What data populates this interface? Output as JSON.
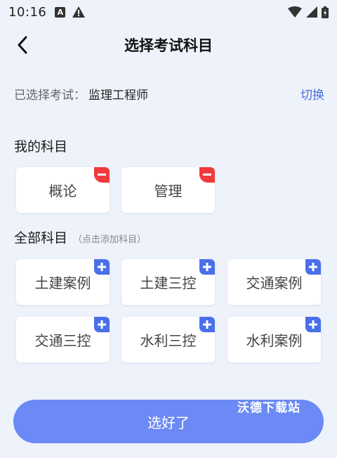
{
  "status_bar": {
    "time": "10:16",
    "notif_a": "A"
  },
  "header": {
    "title": "选择考试科目"
  },
  "exam": {
    "label": "已选择考试：",
    "value": "监理工程师",
    "switch_label": "切换"
  },
  "my_subjects": {
    "title": "我的科目",
    "items": [
      {
        "label": "概论"
      },
      {
        "label": "管理"
      }
    ]
  },
  "all_subjects": {
    "title": "全部科目",
    "hint": "（点击添加科目）",
    "items": [
      {
        "label": "土建案例"
      },
      {
        "label": "土建三控"
      },
      {
        "label": "交通案例"
      },
      {
        "label": "交通三控"
      },
      {
        "label": "水利三控"
      },
      {
        "label": "水利案例"
      }
    ]
  },
  "confirm_label": "选好了",
  "watermark": "沃德下载站",
  "colors": {
    "accent": "#4a6fd9",
    "button": "#6b8af5",
    "remove_badge": "#f03a3a",
    "add_badge": "#4a6fe8",
    "background": "#eef2fb"
  }
}
